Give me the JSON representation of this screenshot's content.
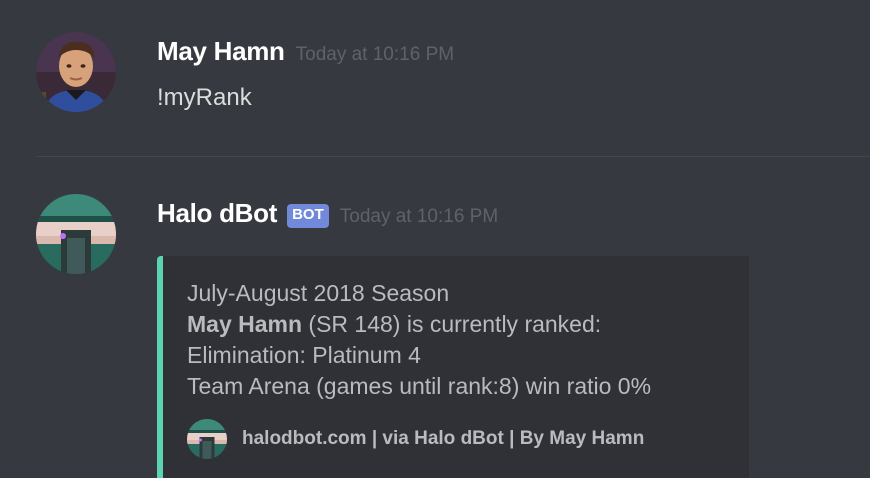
{
  "messages": [
    {
      "username": "May Hamn",
      "timestamp": "Today at 10:16 PM",
      "content": "!myRank",
      "avatar": "user-portrait-icon"
    },
    {
      "username": "Halo dBot",
      "bot_tag": "BOT",
      "timestamp": "Today at 10:16 PM",
      "avatar": "halo-helmet-icon",
      "embed": {
        "accent_color": "#5cd4b4",
        "line1": "July-August 2018 Season",
        "line2_bold": "May Hamn",
        "line2_rest": " (SR 148) is currently ranked:",
        "line3": "Elimination: Platinum 4",
        "line4": "Team Arena (games until rank:8) win ratio 0%",
        "footer_text": "halodbot.com | via Halo dBot | By May Hamn",
        "footer_icon": "halo-helmet-icon"
      }
    }
  ],
  "colors": {
    "background": "#36393f",
    "embed_background": "#2f3136",
    "bot_tag": "#7289da",
    "username": "#ffffff",
    "timestamp": "#5f6268"
  }
}
